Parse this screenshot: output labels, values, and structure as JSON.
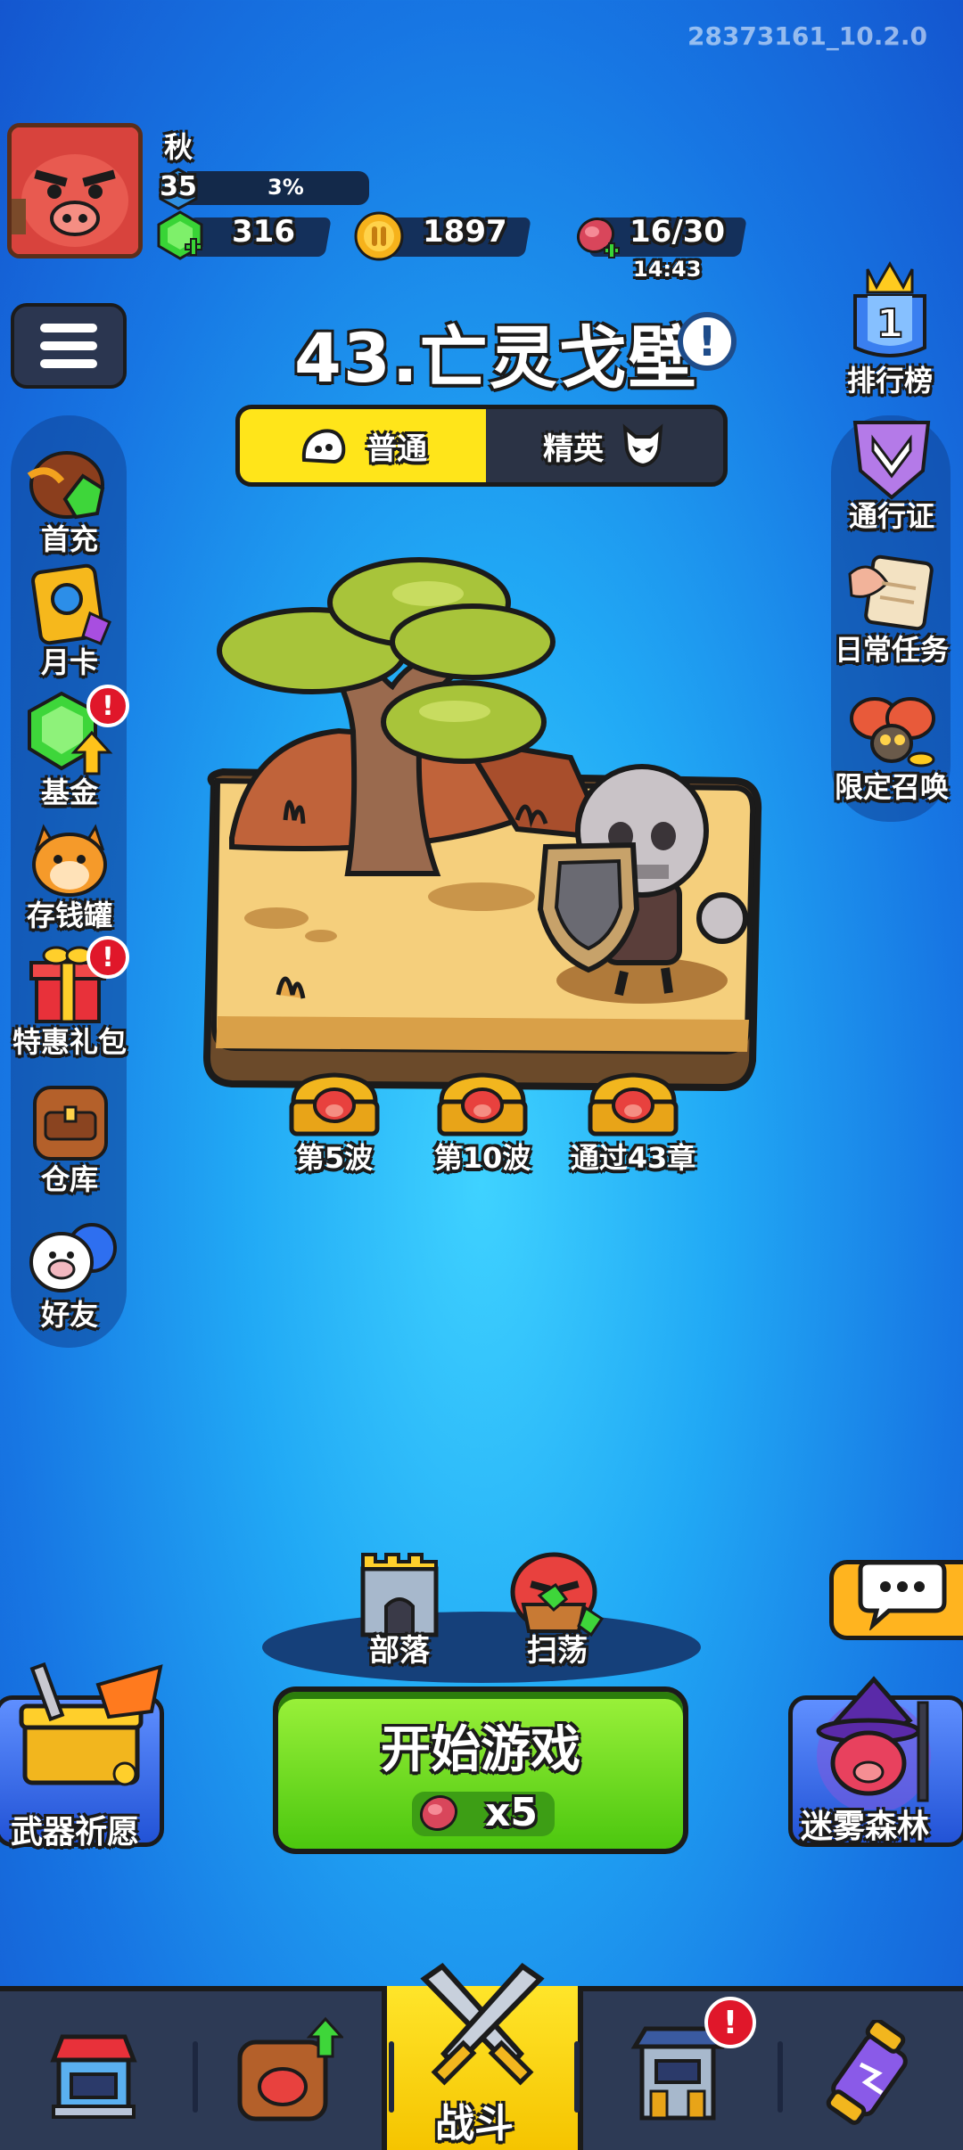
{
  "version": "28373161_10.2.0",
  "player": {
    "name": "秋",
    "level": "35",
    "exp_percent": "3%",
    "gems": "316",
    "coins": "1897",
    "stamina": "16/30",
    "stamina_timer": "14:43"
  },
  "stage": {
    "title": "43.亡灵戈壁",
    "info_icon": "!"
  },
  "modes": {
    "normal": "普通",
    "elite": "精英",
    "selected": "normal"
  },
  "left_menu": [
    {
      "label": "首充",
      "icon": "first-recharge-icon",
      "badge": ""
    },
    {
      "label": "月卡",
      "icon": "monthly-card-icon",
      "badge": ""
    },
    {
      "label": "基金",
      "icon": "fund-icon",
      "badge": "!"
    },
    {
      "label": "存钱罐",
      "icon": "piggy-bank-icon",
      "badge": ""
    },
    {
      "label": "特惠礼包",
      "icon": "gift-pack-icon",
      "badge": "!"
    },
    {
      "label": "仓库",
      "icon": "backpack-icon",
      "badge": ""
    },
    {
      "label": "好友",
      "icon": "friends-icon",
      "badge": ""
    }
  ],
  "right_menu": [
    {
      "label": "排行榜",
      "icon": "leaderboard-icon"
    },
    {
      "label": "通行证",
      "icon": "pass-icon"
    },
    {
      "label": "日常任务",
      "icon": "daily-task-icon"
    },
    {
      "label": "限定召唤",
      "icon": "limited-summon-icon"
    }
  ],
  "rewards": [
    {
      "label": "第5波"
    },
    {
      "label": "第10波"
    },
    {
      "label": "通过43章"
    }
  ],
  "actions": {
    "tribe": "部落",
    "sweep": "扫荡",
    "start": "开始游戏",
    "start_cost": "x5",
    "weapon_wish": "武器祈愿",
    "mist_forest": "迷雾森林"
  },
  "nav": {
    "battle": "战斗",
    "badge": "!",
    "selected": "battle"
  },
  "colors": {
    "accent_yellow": "#ffe51a",
    "start_green": "#6ad922",
    "badge_red": "#e0172a",
    "background_blue": "#21a9f5"
  }
}
